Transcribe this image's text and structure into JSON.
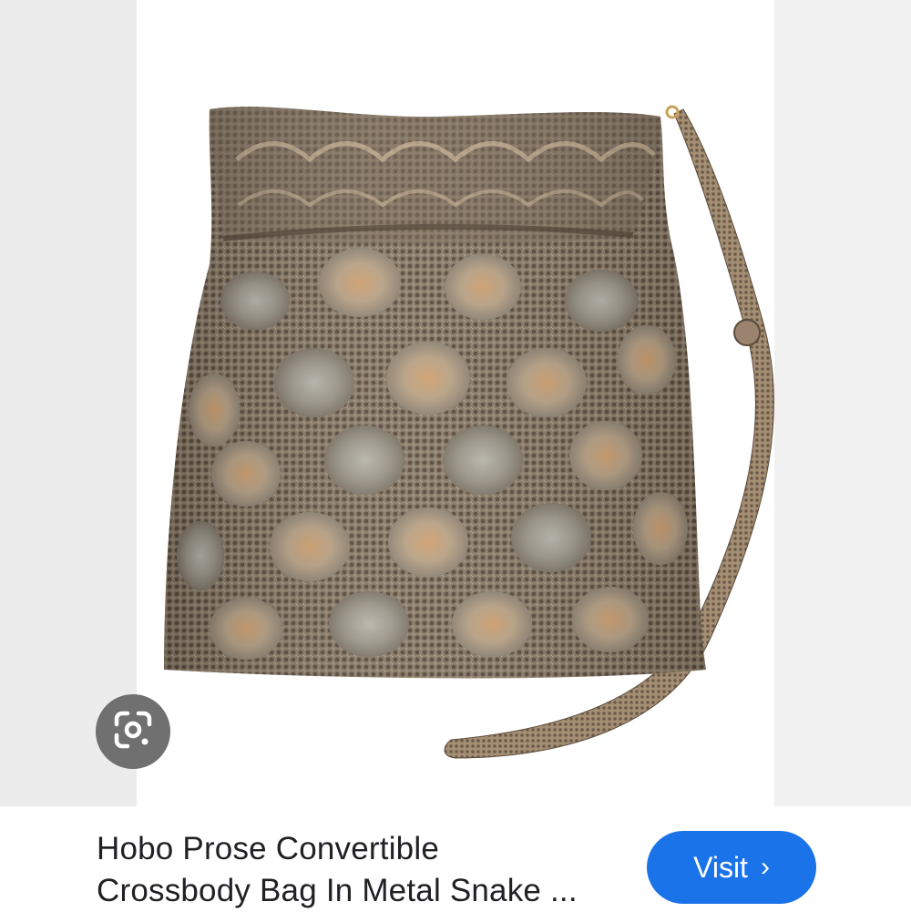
{
  "result": {
    "title_line1": "Hobo Prose Convertible",
    "title_line2": "Crossbody Bag In Metal Snake ...",
    "visit_label": "Visit",
    "visit_chevron": "›"
  },
  "icons": {
    "lens": "google-lens-icon",
    "chevron": "chevron-right-icon"
  },
  "colors": {
    "visit_button": "#1a73e8",
    "lens_button": "#707070",
    "title_text": "#202124"
  }
}
